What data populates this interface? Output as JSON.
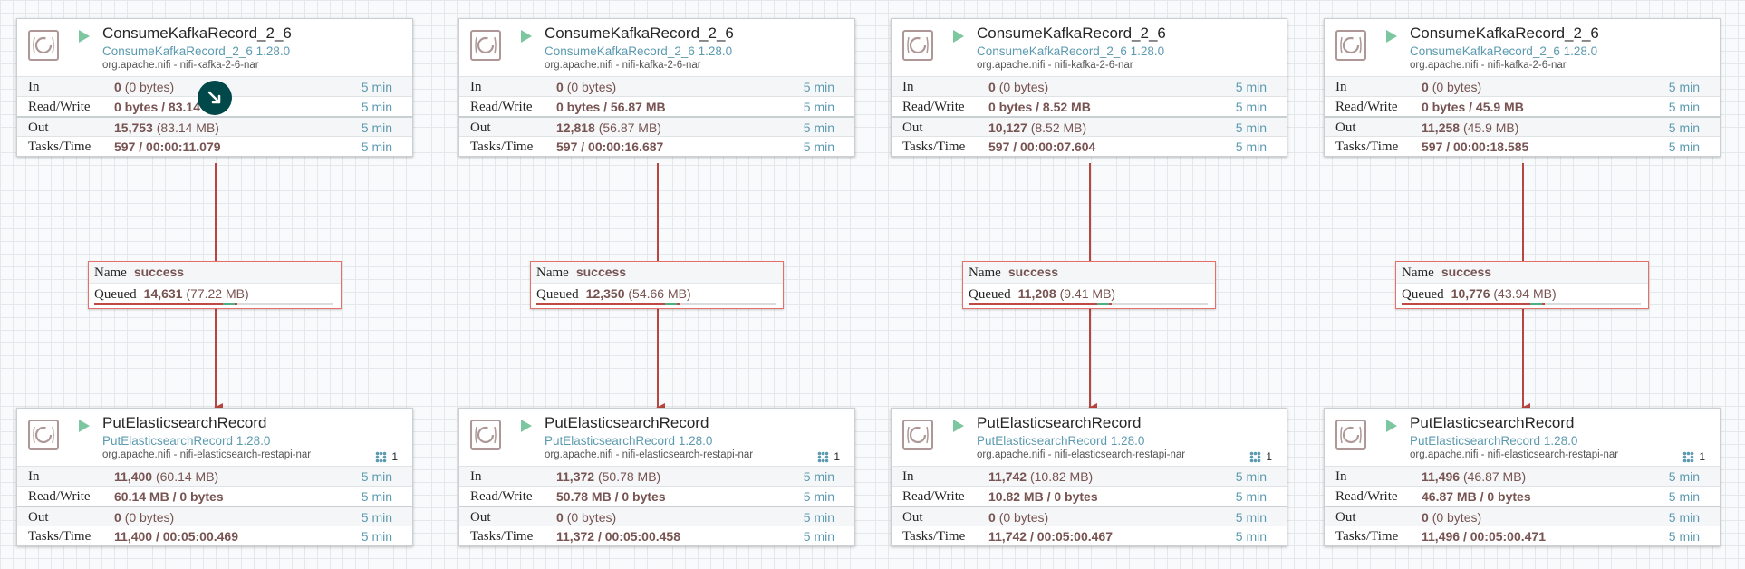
{
  "processors": {
    "p1": {
      "name": "ConsumeKafkaRecord_2_6",
      "type": "ConsumeKafkaRecord_2_6 1.28.0",
      "bundle": "org.apache.nifi - nifi-kafka-2-6-nar",
      "threads": "",
      "in_v": "0",
      "in_p": "(0 bytes)",
      "rw_v": "0 bytes / 83.14 MB",
      "out_v": "15,753",
      "out_p": "(83.14 MB)",
      "tt_v": "597 / 00:00:11.079"
    },
    "p2": {
      "name": "ConsumeKafkaRecord_2_6",
      "type": "ConsumeKafkaRecord_2_6 1.28.0",
      "bundle": "org.apache.nifi - nifi-kafka-2-6-nar",
      "threads": "",
      "in_v": "0",
      "in_p": "(0 bytes)",
      "rw_v": "0 bytes / 56.87 MB",
      "out_v": "12,818",
      "out_p": "(56.87 MB)",
      "tt_v": "597 / 00:00:16.687"
    },
    "p3": {
      "name": "ConsumeKafkaRecord_2_6",
      "type": "ConsumeKafkaRecord_2_6 1.28.0",
      "bundle": "org.apache.nifi - nifi-kafka-2-6-nar",
      "threads": "",
      "in_v": "0",
      "in_p": "(0 bytes)",
      "rw_v": "0 bytes / 8.52 MB",
      "out_v": "10,127",
      "out_p": "(8.52 MB)",
      "tt_v": "597 / 00:00:07.604"
    },
    "p4": {
      "name": "ConsumeKafkaRecord_2_6",
      "type": "ConsumeKafkaRecord_2_6 1.28.0",
      "bundle": "org.apache.nifi - nifi-kafka-2-6-nar",
      "threads": "",
      "in_v": "0",
      "in_p": "(0 bytes)",
      "rw_v": "0 bytes / 45.9 MB",
      "out_v": "11,258",
      "out_p": "(45.9 MB)",
      "tt_v": "597 / 00:00:18.585"
    },
    "p5": {
      "name": "PutElasticsearchRecord",
      "type": "PutElasticsearchRecord 1.28.0",
      "bundle": "org.apache.nifi - nifi-elasticsearch-restapi-nar",
      "threads": "1",
      "in_v": "11,400",
      "in_p": "(60.14 MB)",
      "rw_v": "60.14 MB / 0 bytes",
      "out_v": "0",
      "out_p": "(0 bytes)",
      "tt_v": "11,400 / 00:05:00.469"
    },
    "p6": {
      "name": "PutElasticsearchRecord",
      "type": "PutElasticsearchRecord 1.28.0",
      "bundle": "org.apache.nifi - nifi-elasticsearch-restapi-nar",
      "threads": "1",
      "in_v": "11,372",
      "in_p": "(50.78 MB)",
      "rw_v": "50.78 MB / 0 bytes",
      "out_v": "0",
      "out_p": "(0 bytes)",
      "tt_v": "11,372 / 00:05:00.458"
    },
    "p7": {
      "name": "PutElasticsearchRecord",
      "type": "PutElasticsearchRecord 1.28.0",
      "bundle": "org.apache.nifi - nifi-elasticsearch-restapi-nar",
      "threads": "1",
      "in_v": "11,742",
      "in_p": "(10.82 MB)",
      "rw_v": "10.82 MB / 0 bytes",
      "out_v": "0",
      "out_p": "(0 bytes)",
      "tt_v": "11,742 / 00:05:00.467"
    },
    "p8": {
      "name": "PutElasticsearchRecord",
      "type": "PutElasticsearchRecord 1.28.0",
      "bundle": "org.apache.nifi - nifi-elasticsearch-restapi-nar",
      "threads": "1",
      "in_v": "11,496",
      "in_p": "(46.87 MB)",
      "rw_v": "46.87 MB / 0 bytes",
      "out_v": "0",
      "out_p": "(0 bytes)",
      "tt_v": "11,496 / 00:05:00.471"
    }
  },
  "labels": {
    "in": "In",
    "rw": "Read/Write",
    "out": "Out",
    "tt": "Tasks/Time",
    "window": "5 min"
  },
  "connections": {
    "c1": {
      "name_key": "Name",
      "name": "success",
      "queued_key": "Queued",
      "count": "14,631",
      "size": "(77.22 MB)",
      "count_fill": 0.6,
      "size_fill": 0.05
    },
    "c2": {
      "name_key": "Name",
      "name": "success",
      "queued_key": "Queued",
      "count": "12,350",
      "size": "(54.66 MB)",
      "count_fill": 0.6,
      "size_fill": 0.05
    },
    "c3": {
      "name_key": "Name",
      "name": "success",
      "queued_key": "Queued",
      "count": "11,208",
      "size": "(9.41 MB)",
      "count_fill": 0.6,
      "size_fill": 0.05
    },
    "c4": {
      "name_key": "Name",
      "name": "success",
      "queued_key": "Queued",
      "count": "10,776",
      "size": "(43.94 MB)",
      "count_fill": 0.6,
      "size_fill": 0.05
    }
  },
  "colors": {
    "connection_line": "#b8453f",
    "processor_icon": "#ad9897",
    "running": "#7dc7a0",
    "stat_value": "#775351",
    "stat_time": "#5c9ab0"
  },
  "icons": {
    "processor": "processor-icon",
    "run": "running-icon",
    "threads": "active-threads-icon",
    "cursor": "move-cursor-icon"
  }
}
